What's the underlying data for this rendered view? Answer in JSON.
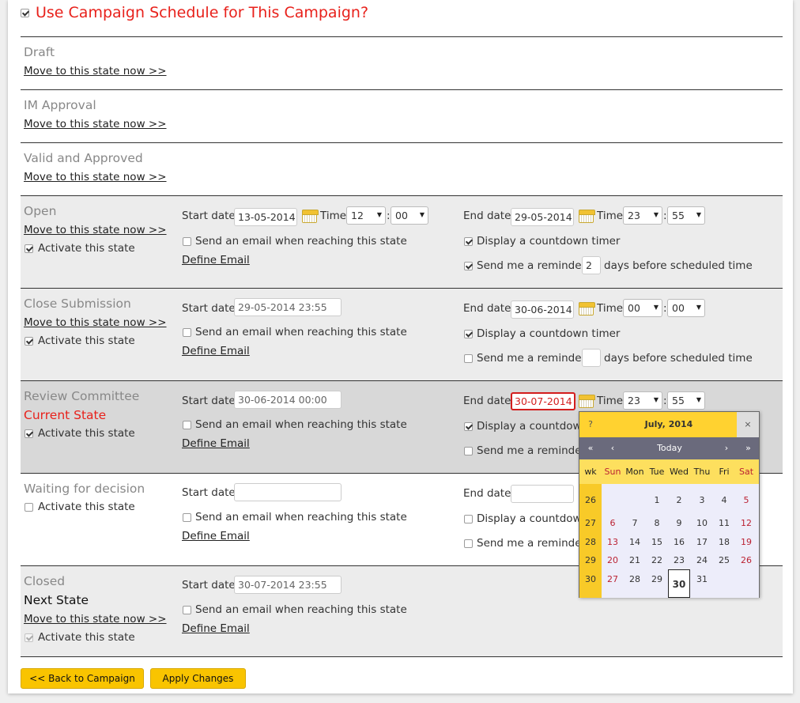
{
  "header": {
    "title": "Use Campaign Schedule for This Campaign?",
    "checked": true
  },
  "move_link": "Move to this state now >>",
  "activate_label": "Activate this state",
  "labels": {
    "start_date": "Start date",
    "end_date": "End date",
    "time": "Time",
    "send_email": "Send an email when reaching this state",
    "define_email": "Define Email",
    "countdown": "Display a countdown timer",
    "countdown_short": "Display a countdow",
    "reminder": "Send me a reminder",
    "reminder_short": "Send me a reminder",
    "days_before": "days before scheduled time",
    "colon": ":"
  },
  "states": [
    {
      "name": "Draft"
    },
    {
      "name": "IM Approval"
    },
    {
      "name": "Valid and Approved"
    },
    {
      "name": "Open",
      "activated": true,
      "start_date": "13-05-2014",
      "start_hour": "12",
      "start_min": "00",
      "end_date": "29-05-2014",
      "end_hour": "23",
      "end_min": "55",
      "send_email": false,
      "countdown": true,
      "reminder": true,
      "reminder_days": "2"
    },
    {
      "name": "Close Submission",
      "activated": true,
      "start_value": "29-05-2014  23:55",
      "end_date": "30-06-2014",
      "end_hour": "00",
      "end_min": "00",
      "send_email": false,
      "countdown": true,
      "reminder": false,
      "reminder_days": ""
    },
    {
      "name": "Review Committee",
      "marker": "Current State",
      "activated": true,
      "start_value": "30-06-2014  00:00",
      "end_date": "30-07-2014",
      "end_hour": "23",
      "end_min": "55",
      "send_email": false,
      "countdown": true,
      "reminder": false
    },
    {
      "name": "Waiting for decision",
      "activated": false,
      "start_value": "",
      "end_value": "",
      "send_email": false,
      "countdown": false,
      "reminder": false
    },
    {
      "name": "Closed",
      "marker": "Next State",
      "activated": true,
      "start_value": "30-07-2014  23:55",
      "send_email": false
    }
  ],
  "calendar": {
    "help": "?",
    "month_label": "July, 2014",
    "close": "×",
    "nav": [
      "«",
      "‹",
      "Today",
      "›",
      "»"
    ],
    "day_names": [
      "wk",
      "Sun",
      "Mon",
      "Tue",
      "Wed",
      "Thu",
      "Fri",
      "Sat"
    ],
    "weeks": [
      {
        "wk": "26",
        "days": [
          "",
          "",
          "1",
          "2",
          "3",
          "4",
          "5"
        ]
      },
      {
        "wk": "27",
        "days": [
          "6",
          "7",
          "8",
          "9",
          "10",
          "11",
          "12"
        ]
      },
      {
        "wk": "28",
        "days": [
          "13",
          "14",
          "15",
          "16",
          "17",
          "18",
          "19"
        ]
      },
      {
        "wk": "29",
        "days": [
          "20",
          "21",
          "22",
          "23",
          "24",
          "25",
          "26"
        ]
      },
      {
        "wk": "30",
        "days": [
          "27",
          "28",
          "29",
          "30",
          "31",
          "",
          ""
        ]
      }
    ],
    "selected_day": "30"
  },
  "buttons": {
    "back": "<< Back to Campaign",
    "apply": "Apply Changes"
  },
  "colors": {
    "accent_red": "#e8211b",
    "button_yellow": "#f9c400",
    "calendar_title": "#ffd230",
    "calendar_nav": "#6a6a7c"
  }
}
